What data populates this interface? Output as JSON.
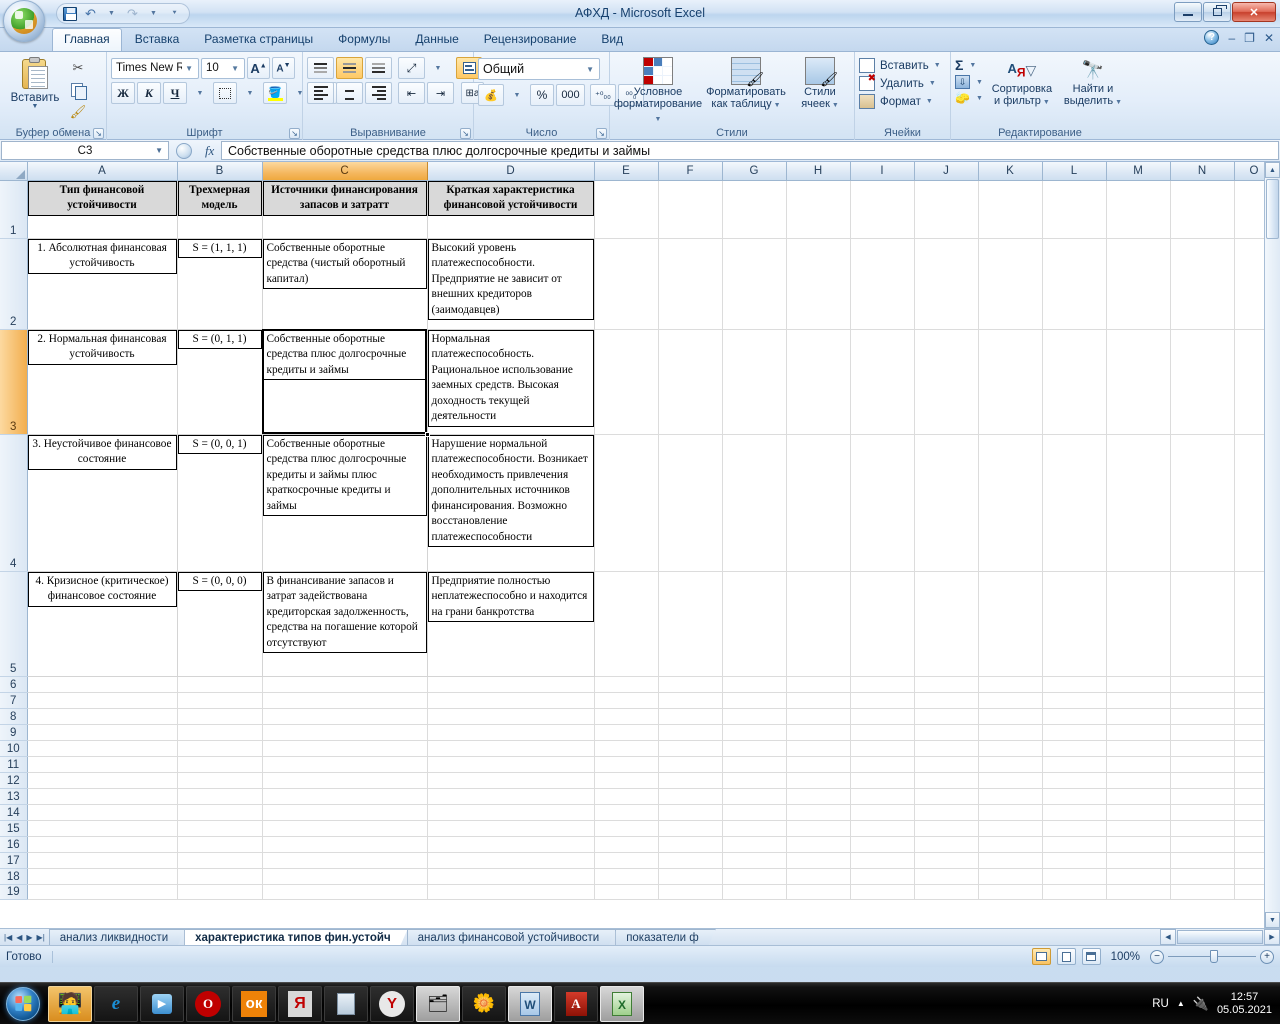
{
  "window": {
    "title": "АФХД - Microsoft Excel",
    "minimize": "—",
    "restore": "❐",
    "close": "✕"
  },
  "quick_access": {
    "save": "save-icon",
    "undo": "undo-icon",
    "redo": "redo-icon",
    "customize": "customize-icon"
  },
  "ribbon_tabs": [
    {
      "label": "Главная",
      "active": true
    },
    {
      "label": "Вставка",
      "active": false
    },
    {
      "label": "Разметка страницы",
      "active": false
    },
    {
      "label": "Формулы",
      "active": false
    },
    {
      "label": "Данные",
      "active": false
    },
    {
      "label": "Рецензирование",
      "active": false
    },
    {
      "label": "Вид",
      "active": false
    }
  ],
  "ribbon": {
    "clipboard": {
      "group_label": "Буфер обмена",
      "paste_label": "Вставить",
      "cut_title": "Вырезать",
      "copy_title": "Копировать",
      "format_painter_title": "Формат по образцу"
    },
    "font": {
      "group_label": "Шрифт",
      "font_name": "Times New Rom",
      "font_size": "10",
      "grow_label": "A",
      "shrink_label": "A",
      "bold_label": "Ж",
      "italic_label": "К",
      "underline_label": "Ч",
      "borders_title": "Границы",
      "fill_color_title": "Цвет заливки",
      "font_color_title": "Цвет шрифта"
    },
    "alignment": {
      "group_label": "Выравнивание",
      "align_top": "align-top-icon",
      "align_middle": "align-middle-icon",
      "align_bottom": "align-bottom-icon",
      "orientation": "orientation-icon",
      "align_left": "align-left-icon",
      "align_center": "align-center-icon",
      "align_right": "align-right-icon",
      "decrease_indent": "decrease-indent-icon",
      "increase_indent": "increase-indent-icon",
      "wrap_text": "wrap-text-icon",
      "merge_cells": "merge-cells-icon"
    },
    "number": {
      "group_label": "Число",
      "format": "Общий",
      "currency": "currency-icon",
      "percent": "%",
      "thousands": "000",
      "increase_decimal": "increase-decimal-icon",
      "decrease_decimal": "decrease-decimal-icon"
    },
    "styles": {
      "group_label": "Стили",
      "conditional": "Условное\nформатирование",
      "conditional_l1": "Условное",
      "conditional_l2": "форматирование",
      "as_table_l1": "Форматировать",
      "as_table_l2": "как таблицу",
      "cell_styles_l1": "Стили",
      "cell_styles_l2": "ячеек"
    },
    "cells": {
      "group_label": "Ячейки",
      "insert": "Вставить",
      "delete": "Удалить",
      "format": "Формат"
    },
    "editing": {
      "group_label": "Редактирование",
      "sum": "Σ",
      "sort_l1": "Сортировка",
      "sort_l2": "и фильтр",
      "find_l1": "Найти и",
      "find_l2": "выделить"
    }
  },
  "formula_bar": {
    "name_box": "C3",
    "fx_label": "fx",
    "value": "Собственные оборотные средства плюс долгосрочные кредиты и займы"
  },
  "grid": {
    "columns": [
      "A",
      "B",
      "C",
      "D",
      "E",
      "F",
      "G",
      "H",
      "I",
      "J",
      "K",
      "L",
      "M",
      "N",
      "O"
    ],
    "selected_column": "C",
    "selected_row": "3",
    "row_numbers": [
      "1",
      "2",
      "3",
      "4",
      "5",
      "6",
      "7",
      "8",
      "9",
      "10",
      "11",
      "12",
      "13",
      "14",
      "15",
      "16",
      "17",
      "18",
      "19"
    ],
    "header_row": [
      "Тип финансовой устойчивости",
      "Трехмерная модель",
      "Источники финансирования запасов и затратт",
      "Краткая характеристика финансовой устойчивости"
    ],
    "rows": [
      {
        "type": "1. Абсолютная финансовая устойчивость",
        "model": "S = (1, 1, 1)",
        "sources": "Собственные оборотные средства (чистый оборотный капитал)",
        "characteristic": "Высокий уровень платежеспособности. Предприятие не зависит от внешних кредиторов (заимодавцев)"
      },
      {
        "type": "2. Нормальная финансовая устойчивость",
        "model": "S = (0, 1, 1)",
        "sources": "Собственные оборотные средства плюс долгосрочные кредиты и займы",
        "characteristic": "Нормальная платежеспособность. Рациональное использование заемных средств. Высокая доходность текущей деятельности"
      },
      {
        "type": "3. Неустойчивое финансовое состояние",
        "model": "S = (0, 0, 1)",
        "sources": "Собственные оборотные средства плюс долгосрочные кредиты и займы плюс краткосрочные кредиты и займы",
        "characteristic": "Нарушение нормальной платежеспособности. Возникает необходимость привлечения дополнительных источников финансирования. Возможно восстановление платежеспособности"
      },
      {
        "type": "4. Кризисное (критическое) финансовое состояние",
        "model": "S = (0, 0, 0)",
        "sources": "В финансивание запасов и затрат задействована кредиторская задолженность, средства на погашение которой отсутствуют",
        "characteristic": "Предприятие полностью неплатежеспособно и находится на грани банкротства"
      }
    ]
  },
  "sheet_tabs": [
    {
      "label": "анализ ликвидности",
      "active": false
    },
    {
      "label": "характеристика типов фин.устойч",
      "active": true
    },
    {
      "label": "анализ финансовой устойчивости",
      "active": false
    },
    {
      "label": "показатели ф",
      "active": false
    }
  ],
  "status_bar": {
    "state": "Готово",
    "zoom": "100%",
    "view_normal": "normal-view-icon",
    "view_page_layout": "page-layout-view-icon",
    "view_page_break": "page-break-view-icon",
    "zoom_out": "−",
    "zoom_in": "+"
  },
  "taskbar": {
    "start": "start-button",
    "items": [
      {
        "name": "agent-app-icon",
        "active": true
      },
      {
        "name": "internet-explorer-icon",
        "active": false
      },
      {
        "name": "media-player-icon",
        "active": false
      },
      {
        "name": "opera-icon",
        "active": false
      },
      {
        "name": "odnoklassniki-icon",
        "active": false
      },
      {
        "name": "yandex-icon",
        "active": false
      },
      {
        "name": "calculator-icon",
        "active": false
      },
      {
        "name": "yandex-browser-icon",
        "active": false
      },
      {
        "name": "explorer-icon",
        "active": false
      },
      {
        "name": "icq-icon",
        "active": false
      },
      {
        "name": "word-icon",
        "active": false
      },
      {
        "name": "acrobat-icon",
        "active": false
      },
      {
        "name": "excel-icon",
        "active": true
      }
    ],
    "tray": {
      "language": "RU",
      "time": "12:57",
      "date": "05.05.2021"
    }
  },
  "colors": {
    "accent_orange": "#f5b860",
    "title_blue": "#16406e",
    "header_fill": "#d9d9d9"
  }
}
